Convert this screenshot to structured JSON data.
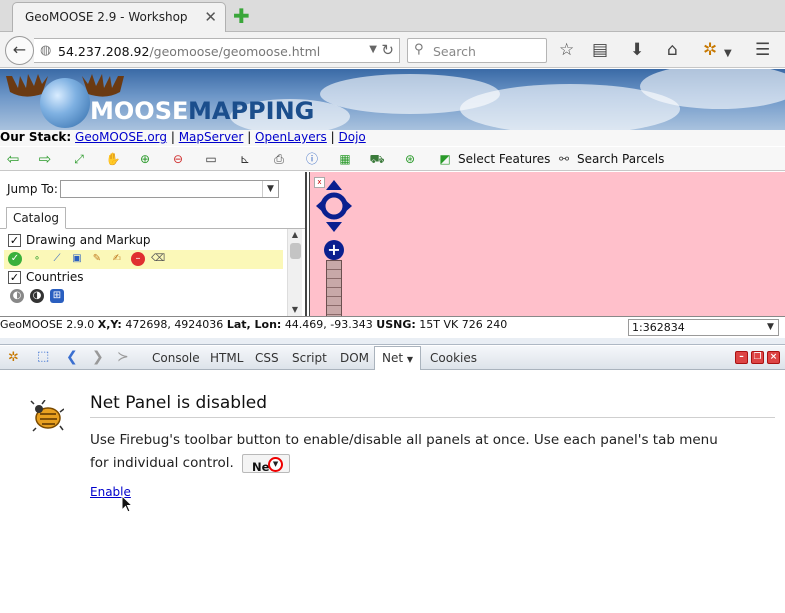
{
  "browser": {
    "tab_title": "GeoMOOSE 2.9 - Workshop",
    "tab_close": "✕",
    "new_tab": "✚",
    "url_host": "54.237.208.92",
    "url_path": "/geomoose/geomoose.html",
    "search_placeholder": "Search"
  },
  "banner": {
    "logo_part1": "MOOSE",
    "logo_part2": "MAPPING"
  },
  "stack": {
    "label": "Our Stack:",
    "links": [
      "GeoMOOSE.org",
      "MapServer",
      "OpenLayers",
      "Dojo"
    ],
    "separator": " | "
  },
  "toolbar": {
    "icons": [
      "back-arrow-icon",
      "forward-arrow-icon",
      "zoom-extent-icon",
      "pan-hand-icon",
      "zoom-in-icon",
      "zoom-out-icon",
      "measure-icon",
      "measure-area-icon",
      "print-icon",
      "identify-icon",
      "layer-icon",
      "vehicle-icon",
      "locate-icon"
    ],
    "select_features": "Select Features",
    "search_parcels": "Search Parcels"
  },
  "leftpanel": {
    "jump_label": "Jump To:",
    "jump_value": "",
    "catalog_tab": "Catalog",
    "layers": [
      {
        "label": "Drawing and Markup",
        "checked": true
      },
      {
        "label": "Countries",
        "checked": true
      }
    ]
  },
  "status": {
    "version": "GeoMOOSE 2.9.0",
    "xy_label": "X,Y:",
    "xy_value": "472698, 4924036",
    "latlon_label": "Lat, Lon:",
    "latlon_value": "44.469, -93.343",
    "usng_label": "USNG:",
    "usng_value": "15T VK 726 240",
    "scale": "1:362834"
  },
  "firebug": {
    "tabs": [
      "Console",
      "HTML",
      "CSS",
      "Script",
      "DOM",
      "Net",
      "Cookies"
    ],
    "active_tab": "Net",
    "heading": "Net Panel is disabled",
    "desc_before": "Use Firebug's toolbar button to enable/disable all panels at once. Use each panel's tab menu for individual control.",
    "net_button_label": "Net",
    "enable_link": "Enable"
  },
  "colors": {
    "map_background": "#ffc0cb",
    "highlight_row": "#fbf8b8",
    "link": "#0000cc"
  }
}
